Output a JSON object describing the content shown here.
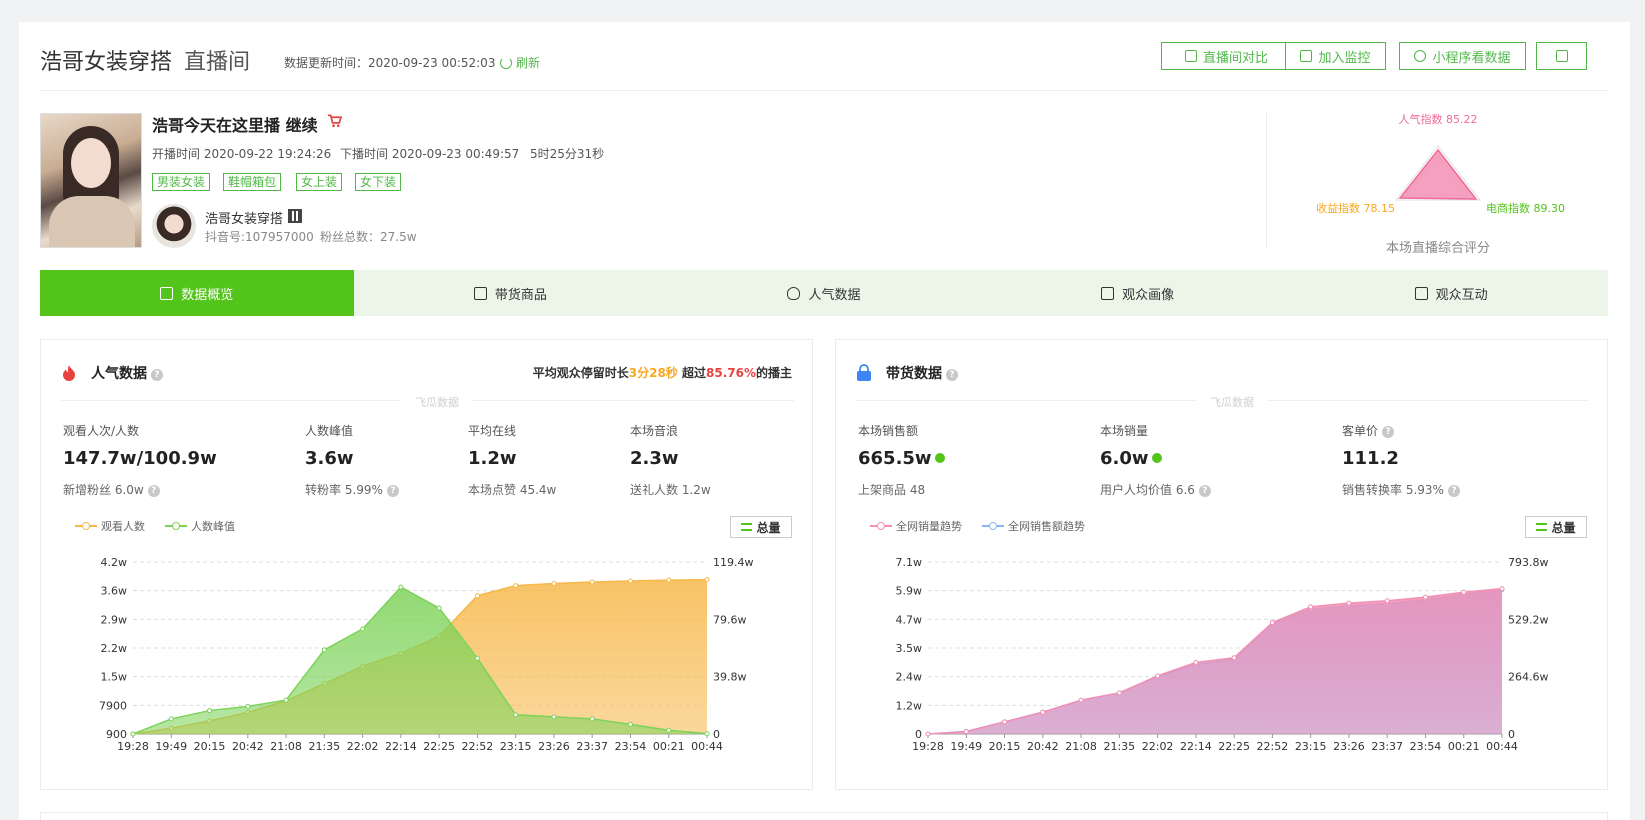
{
  "header": {
    "title": "浩哥女装穿搭",
    "subtitle": "直播间",
    "update_time": "数据更新时间：2020-09-23 00:52:03",
    "refresh": "刷新",
    "buttons": [
      "直播间对比",
      "加入监控",
      "小程序看数据"
    ]
  },
  "live": {
    "title": "浩哥今天在这里播 继续",
    "start": "开播时间 2020-09-22 19:24:26",
    "end": "下播时间 2020-09-23 00:49:57",
    "duration": "5时25分31秒",
    "tags": [
      "男装女装",
      "鞋帽箱包",
      "女上装",
      "女下装"
    ],
    "anchor_name": "浩哥女装穿搭",
    "douyin_id": "抖音号:107957000",
    "fans": "粉丝总数：27.5w"
  },
  "radar": {
    "popularity": "人气指数 85.22",
    "income": "收益指数 78.15",
    "ecommerce": "电商指数 89.30",
    "caption": "本场直播综合评分"
  },
  "tabs": [
    "数据概览",
    "带货商品",
    "人气数据",
    "观众画像",
    "观众互动"
  ],
  "popularity_panel": {
    "title": "人气数据",
    "watermark": "飞瓜数据",
    "stay_prefix": "平均观众停留时长",
    "stay_time": "3分28秒",
    "stay_mid": " 超过",
    "stay_pct": "85.76%",
    "stay_suffix": "的播主",
    "metrics": [
      {
        "label": "观看人次/人数",
        "value": "147.7w/100.9w",
        "sub": "新增粉丝 6.0w"
      },
      {
        "label": "人数峰值",
        "value": "3.6w",
        "sub": "转粉率 5.99%"
      },
      {
        "label": "平均在线",
        "value": "1.2w",
        "sub": "本场点赞 45.4w"
      },
      {
        "label": "本场音浪",
        "value": "2.3w",
        "sub": "送礼人数 1.2w"
      }
    ],
    "legend": [
      "观看人数",
      "人数峰值"
    ],
    "total": "总量"
  },
  "sales_panel": {
    "title": "带货数据",
    "watermark": "飞瓜数据",
    "metrics": [
      {
        "label": "本场销售额",
        "value": "665.5w",
        "sub": "上架商品 48"
      },
      {
        "label": "本场销量",
        "value": "6.0w",
        "sub": "用户人均价值 6.6"
      },
      {
        "label": "客单价",
        "value": "111.2",
        "sub": "销售转换率 5.93%"
      }
    ],
    "legend": [
      "全网销量趋势",
      "全网销售额趋势"
    ],
    "total": "总量"
  },
  "chart_data": [
    {
      "type": "area",
      "x": [
        "19:28",
        "19:49",
        "20:15",
        "20:42",
        "21:08",
        "21:35",
        "22:02",
        "22:14",
        "22:25",
        "22:52",
        "23:15",
        "23:26",
        "23:37",
        "23:54",
        "00:21",
        "00:44"
      ],
      "y_left_ticks": [
        "900",
        "7900",
        "1.5w",
        "2.2w",
        "2.9w",
        "3.6w",
        "4.2w"
      ],
      "y_right_ticks": [
        "0",
        "39.8w",
        "79.6w",
        "119.4w"
      ],
      "series": [
        {
          "name": "人数峰值",
          "axis": "left",
          "color": "#7dd35a",
          "values": [
            900,
            4500,
            6500,
            7500,
            9000,
            21000,
            26000,
            36000,
            31000,
            19000,
            5500,
            5000,
            4500,
            3200,
            1800,
            1000
          ]
        },
        {
          "name": "观看人数",
          "axis": "right",
          "color": "#f7b84a",
          "values": [
            0,
            40000,
            90000,
            150000,
            230000,
            350000,
            470000,
            560000,
            680000,
            960000,
            1030000,
            1045000,
            1055000,
            1062000,
            1068000,
            1072000
          ]
        }
      ]
    },
    {
      "type": "area",
      "x": [
        "19:28",
        "19:49",
        "20:15",
        "20:42",
        "21:08",
        "21:35",
        "22:02",
        "22:14",
        "22:25",
        "22:52",
        "23:15",
        "23:26",
        "23:37",
        "23:54",
        "00:21",
        "00:44"
      ],
      "y_left_ticks": [
        "0",
        "1.2w",
        "2.4w",
        "3.5w",
        "4.7w",
        "5.9w",
        "7.1w"
      ],
      "y_right_ticks": [
        "0",
        "264.6w",
        "529.2w",
        "793.8w"
      ],
      "series": [
        {
          "name": "全网销量趋势",
          "axis": "left",
          "color": "#f38fb4",
          "values": [
            0,
            1000,
            5000,
            9000,
            14000,
            17000,
            24000,
            29500,
            31500,
            46000,
            52500,
            54000,
            55000,
            56500,
            58500,
            60000
          ]
        },
        {
          "name": "全网销售额趋势",
          "axis": "right",
          "color": "#8ab6f5",
          "values": [
            0,
            120000,
            560000,
            1010000,
            1550000,
            1890000,
            2650000,
            3210000,
            3450000,
            5120000,
            5760000,
            5920000,
            6020000,
            6200000,
            6450000,
            6655000
          ]
        }
      ]
    }
  ]
}
